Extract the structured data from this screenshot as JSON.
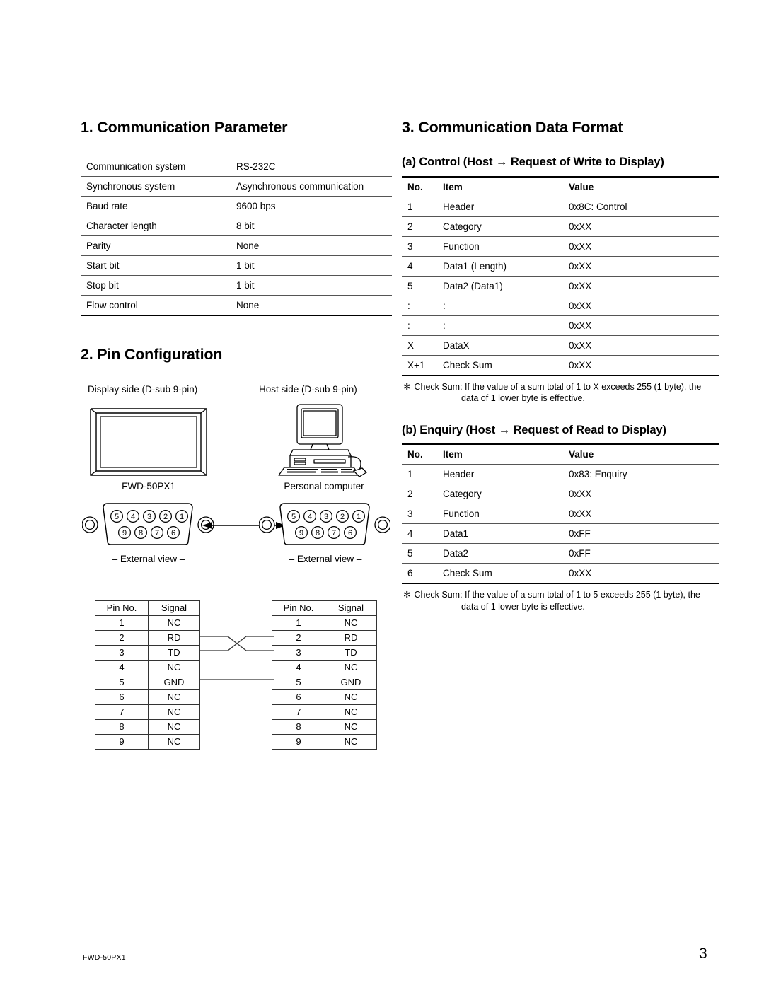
{
  "footer": {
    "model": "FWD-50PX1",
    "page_number": "3"
  },
  "section1": {
    "title": "1. Communication Parameter",
    "table": {
      "rows": [
        {
          "label": "Communication system",
          "value": "RS-232C"
        },
        {
          "label": "Synchronous system",
          "value": "Asynchronous communication"
        },
        {
          "label": "Baud rate",
          "value": "9600 bps"
        },
        {
          "label": "Character length",
          "value": "8 bit"
        },
        {
          "label": "Parity",
          "value": "None"
        },
        {
          "label": "Start bit",
          "value": "1 bit"
        },
        {
          "label": "Stop bit",
          "value": "1 bit"
        },
        {
          "label": "Flow control",
          "value": "None"
        }
      ]
    }
  },
  "section2": {
    "title": "2. Pin Configuration",
    "display_side": {
      "label": "Display side (D-sub 9-pin)",
      "device_caption": "FWD-50PX1",
      "external_view": "– External view –",
      "pins_top": [
        "5",
        "4",
        "3",
        "2",
        "1"
      ],
      "pins_bottom": [
        "9",
        "8",
        "7",
        "6"
      ]
    },
    "host_side": {
      "label": "Host side (D-sub 9-pin)",
      "device_caption": "Personal computer",
      "external_view": "– External view –",
      "pins_top": [
        "5",
        "4",
        "3",
        "2",
        "1"
      ],
      "pins_bottom": [
        "9",
        "8",
        "7",
        "6"
      ]
    },
    "pin_table": {
      "headers": [
        "Pin No.",
        "Signal"
      ],
      "display_rows": [
        [
          "1",
          "NC"
        ],
        [
          "2",
          "RD"
        ],
        [
          "3",
          "TD"
        ],
        [
          "4",
          "NC"
        ],
        [
          "5",
          "GND"
        ],
        [
          "6",
          "NC"
        ],
        [
          "7",
          "NC"
        ],
        [
          "8",
          "NC"
        ],
        [
          "9",
          "NC"
        ]
      ],
      "host_rows": [
        [
          "1",
          "NC"
        ],
        [
          "2",
          "RD"
        ],
        [
          "3",
          "TD"
        ],
        [
          "4",
          "NC"
        ],
        [
          "5",
          "GND"
        ],
        [
          "6",
          "NC"
        ],
        [
          "7",
          "NC"
        ],
        [
          "8",
          "NC"
        ],
        [
          "9",
          "NC"
        ]
      ]
    }
  },
  "section3": {
    "title": "3. Communication Data Format",
    "control": {
      "title": "(a) Control (Host → Request of Write to Display)",
      "headers": {
        "no": "No.",
        "item": "Item",
        "value": "Value"
      },
      "rows": [
        {
          "no": "1",
          "item": "Header",
          "value": "0x8C: Control"
        },
        {
          "no": "2",
          "item": "Category",
          "value": "0xXX"
        },
        {
          "no": "3",
          "item": "Function",
          "value": "0xXX"
        },
        {
          "no": "4",
          "item": "Data1 (Length)",
          "value": "0xXX"
        },
        {
          "no": "5",
          "item": "Data2 (Data1)",
          "value": "0xXX"
        },
        {
          "no": ":",
          "item": ":",
          "value": "0xXX"
        },
        {
          "no": ":",
          "item": ":",
          "value": "0xXX"
        },
        {
          "no": "X",
          "item": "DataX",
          "value": "0xXX"
        },
        {
          "no": "X+1",
          "item": "Check Sum",
          "value": "0xXX"
        }
      ],
      "footnote": {
        "mark": "✻",
        "line1": "Check Sum: If the value of a sum total of 1 to X exceeds 255 (1 byte), the",
        "line2": "data of 1 lower byte is effective."
      }
    },
    "enquiry": {
      "title": "(b) Enquiry (Host → Request of Read to Display)",
      "headers": {
        "no": "No.",
        "item": "Item",
        "value": "Value"
      },
      "rows": [
        {
          "no": "1",
          "item": "Header",
          "value": "0x83: Enquiry"
        },
        {
          "no": "2",
          "item": "Category",
          "value": "0xXX"
        },
        {
          "no": "3",
          "item": "Function",
          "value": "0xXX"
        },
        {
          "no": "4",
          "item": "Data1",
          "value": "0xFF"
        },
        {
          "no": "5",
          "item": "Data2",
          "value": "0xFF"
        },
        {
          "no": "6",
          "item": "Check Sum",
          "value": "0xXX"
        }
      ],
      "footnote": {
        "mark": "✻",
        "line1": "Check Sum: If the value of a sum total of 1 to 5 exceeds 255 (1 byte), the",
        "line2": "data of 1 lower byte is effective."
      }
    }
  }
}
